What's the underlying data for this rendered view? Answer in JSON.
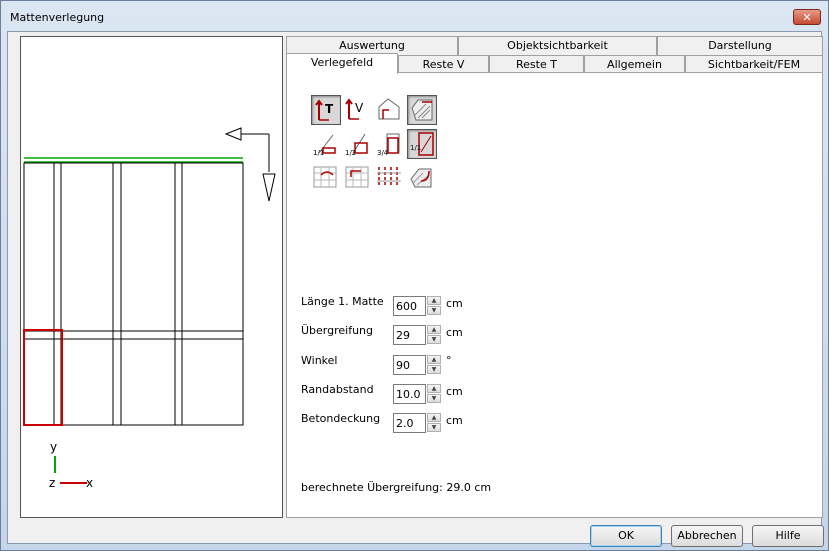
{
  "window": {
    "title": "Mattenverlegung",
    "close_glyph": "✕"
  },
  "tabs_row1": [
    "Auswertung",
    "Objektsichtbarkeit",
    "Darstellung"
  ],
  "tabs_row2": [
    "Verlegefeld",
    "Reste V",
    "Reste T",
    "Allgemein",
    "Sichtbarkeit/FEM"
  ],
  "active_tab": "Verlegefeld",
  "icons": [
    [
      "layout-lt-icon",
      "layout-lv-icon",
      "house-corner-icon",
      "hatched-area-icon"
    ],
    [
      "ratio-1-1-icon",
      "ratio-1-2-icon",
      "ratio-3-4-icon",
      "ratio-full-icon"
    ],
    [
      "mat-shift-left-icon",
      "mat-shift-right-icon",
      "mat-grid-icon",
      "mat-rotate-icon"
    ]
  ],
  "fields": {
    "laenge": {
      "label": "Länge 1. Matte",
      "value": "600",
      "unit": "cm"
    },
    "uebergreifung": {
      "label": "Übergreifung",
      "value": "29",
      "unit": "cm"
    },
    "winkel": {
      "label": "Winkel",
      "value": "90",
      "unit": "°"
    },
    "randabstand": {
      "label": "Randabstand",
      "value": "10.0",
      "unit": "cm"
    },
    "betondeckung": {
      "label": "Betondeckung",
      "value": "2.0",
      "unit": "cm"
    }
  },
  "calculated": {
    "label": "berechnete Übergreifung:",
    "value": "29.0 cm"
  },
  "axes": {
    "y": "y",
    "z": "z",
    "x": "x"
  },
  "buttons": {
    "ok": "OK",
    "cancel": "Abbrechen",
    "help": "Hilfe"
  },
  "colors": {
    "accent_red": "#cc0000",
    "green": "#00aa00"
  }
}
